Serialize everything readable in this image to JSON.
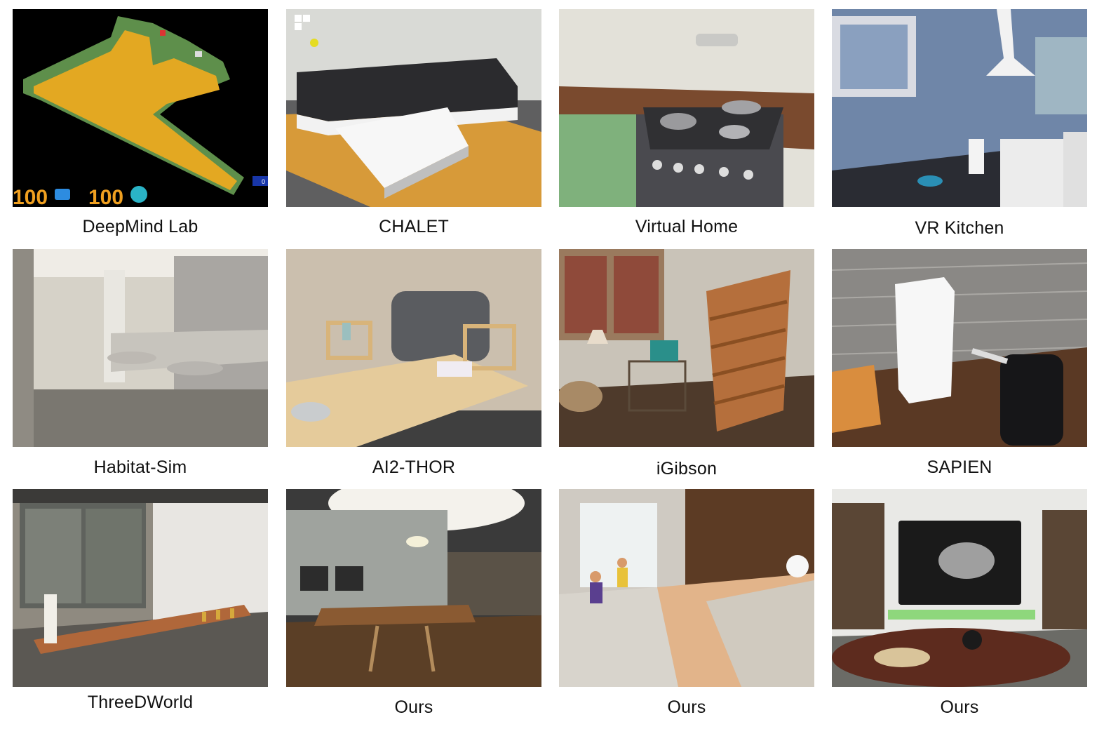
{
  "figure": {
    "panels": [
      {
        "caption": "DeepMind Lab",
        "hud_left": "100",
        "hud_right": "100",
        "hud_box": "0"
      },
      {
        "caption": "CHALET"
      },
      {
        "caption": "Virtual Home"
      },
      {
        "caption": "VR Kitchen"
      },
      {
        "caption": "Habitat-Sim"
      },
      {
        "caption": "AI2-THOR"
      },
      {
        "caption": "iGibson"
      },
      {
        "caption": "SAPIEN"
      },
      {
        "caption": "ThreeDWorld"
      },
      {
        "caption": "Ours"
      },
      {
        "caption": "Ours"
      },
      {
        "caption": "Ours"
      }
    ]
  }
}
